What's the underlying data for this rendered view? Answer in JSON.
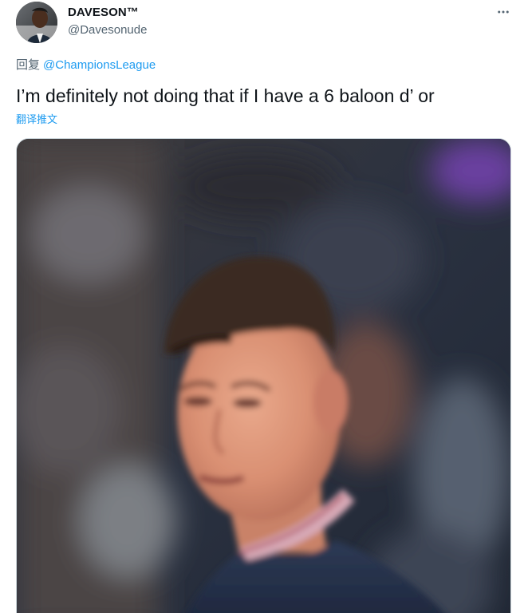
{
  "tweet": {
    "author": {
      "display_name": "DAVESON™",
      "handle": "@Davesonude",
      "avatar_icon": "profile-avatar"
    },
    "more_icon": "more-horizontal-icon",
    "reply_to": {
      "prefix": "回复",
      "mention": "@ChampionsLeague"
    },
    "text": "I’m definitely not doing that if I have a 6 baloon d’ or",
    "translate_label": "翻译推文",
    "media": {
      "kind": "photo",
      "description_icon": "player-photo"
    }
  },
  "colors": {
    "text_primary": "#0f1419",
    "text_secondary": "#536471",
    "link": "#1d9bf0",
    "border": "#cfd9de"
  }
}
